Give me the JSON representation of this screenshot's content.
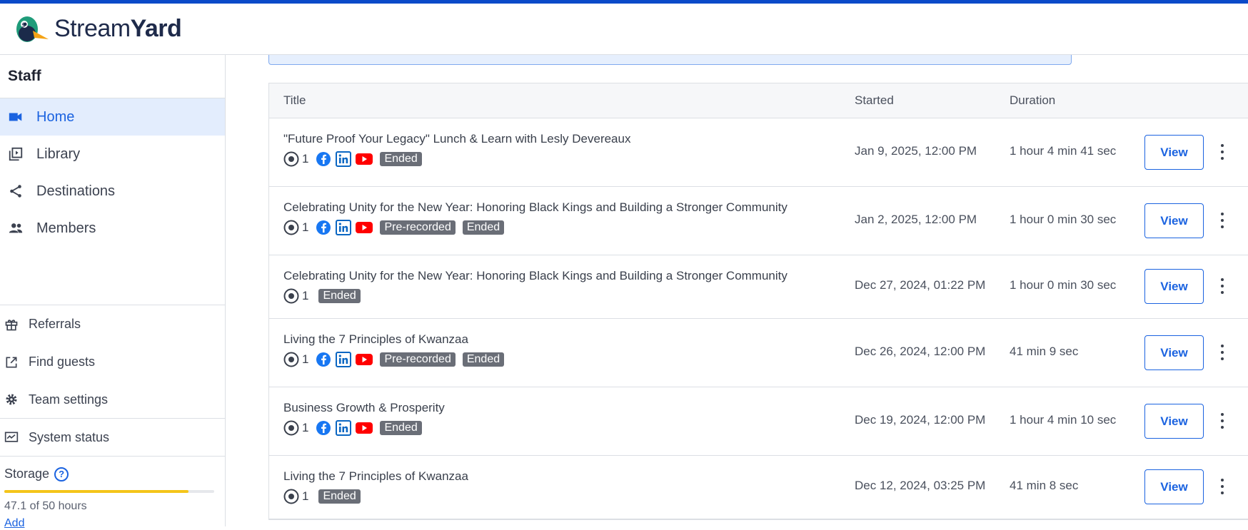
{
  "brand": {
    "name_regular": "Stream",
    "name_bold": "Yard"
  },
  "sidebar": {
    "org": "Staff",
    "nav": [
      {
        "label": "Home",
        "icon": "video-camera-icon",
        "active": true
      },
      {
        "label": "Library",
        "icon": "library-icon"
      },
      {
        "label": "Destinations",
        "icon": "share-icon"
      },
      {
        "label": "Members",
        "icon": "members-icon"
      }
    ],
    "secondary": [
      {
        "label": "Referrals",
        "icon": "gift-icon"
      },
      {
        "label": "Find guests",
        "icon": "external-link-icon"
      },
      {
        "label": "Team settings",
        "icon": "gear-icon"
      },
      {
        "label": "System status",
        "icon": "monitor-icon"
      }
    ],
    "storage": {
      "label": "Storage",
      "help": "?",
      "used_text": "47.1 of 50 hours",
      "fraction": 0.942,
      "add": "Add"
    }
  },
  "table": {
    "headers": {
      "title": "Title",
      "started": "Started",
      "duration": "Duration"
    },
    "view_label": "View",
    "rows": [
      {
        "title": "\"Future Proof Your Legacy\" Lunch & Learn with Lesly Devereaux",
        "count": "1",
        "platforms": true,
        "badges": [
          "Ended"
        ],
        "started": "Jan 9, 2025, 12:00 PM",
        "duration": "1 hour 4 min 41 sec"
      },
      {
        "title": "Celebrating Unity for the New Year: Honoring Black Kings and Building a Stronger Community",
        "count": "1",
        "platforms": true,
        "badges": [
          "Pre-recorded",
          "Ended"
        ],
        "started": "Jan 2, 2025, 12:00 PM",
        "duration": "1 hour 0 min 30 sec"
      },
      {
        "title": "Celebrating Unity for the New Year: Honoring Black Kings and Building a Stronger Community",
        "count": "1",
        "platforms": false,
        "badges": [
          "Ended"
        ],
        "started": "Dec 27, 2024, 01:22 PM",
        "duration": "1 hour 0 min 30 sec"
      },
      {
        "title": "Living the 7 Principles of Kwanzaa",
        "count": "1",
        "platforms": true,
        "badges": [
          "Pre-recorded",
          "Ended"
        ],
        "started": "Dec 26, 2024, 12:00 PM",
        "duration": "41 min 9 sec"
      },
      {
        "title": "Business Growth & Prosperity",
        "count": "1",
        "platforms": true,
        "badges": [
          "Ended"
        ],
        "started": "Dec 19, 2024, 12:00 PM",
        "duration": "1 hour 4 min 10 sec"
      },
      {
        "title": "Living the 7 Principles of Kwanzaa",
        "count": "1",
        "platforms": false,
        "badges": [
          "Ended"
        ],
        "started": "Dec 12, 2024, 03:25 PM",
        "duration": "41 min 8 sec"
      }
    ]
  },
  "colors": {
    "accent": "#1b63e0",
    "topstripe": "#0b4ac9",
    "storage_fill": "#f4c51a",
    "facebook": "#1877f2",
    "linkedin": "#0a66c2",
    "youtube": "#ff0000"
  }
}
